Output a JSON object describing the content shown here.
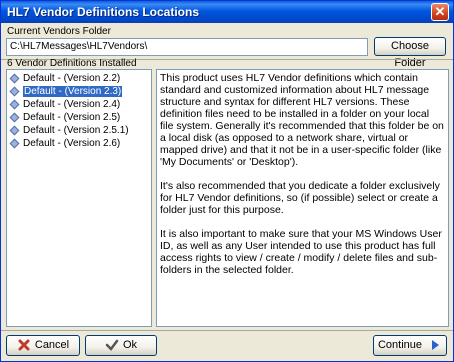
{
  "window": {
    "title": "HL7 Vendor Definitions Locations"
  },
  "current_folder": {
    "label": "Current Vendors Folder",
    "value": "C:\\HL7Messages\\HL7Vendors\\",
    "choose_button": "Choose Folder"
  },
  "installed": {
    "label": "6 Vendor Definitions Installed",
    "items": [
      "Default - (Version 2.2)",
      "Default - (Version 2.3)",
      "Default - (Version 2.4)",
      "Default - (Version 2.5)",
      "Default - (Version 2.5.1)",
      "Default - (Version 2.6)"
    ],
    "selected_index": 1
  },
  "info": {
    "paragraphs": [
      "This product uses HL7 Vendor definitions which contain standard and customized information about HL7 message structure and syntax for different HL7 versions. These definition files need to be installed in a folder on your local file system. Generally it's recommended that this folder be on a local disk (as opposed to a network share, virtual or mapped drive) and that it not be in a user-specific folder (like 'My Documents' or 'Desktop').",
      "It's also recommended that you dedicate a folder exclusively for HL7 Vendor definitions, so (if possible) select or create a folder just for this purpose.",
      "It is also important to make sure that your MS Windows User ID, as well as any User intended to use  this product has full access rights to view / create / modify / delete files and sub-folders in the selected folder."
    ]
  },
  "footer": {
    "cancel": "Cancel",
    "ok": "Ok",
    "continue": "Continue"
  },
  "colors": {
    "selection": "#316ac5",
    "titlebar": "#0054e3"
  },
  "icons": {
    "cancel": "red-x-icon",
    "ok": "check-icon",
    "continue": "blue-arrow-right-icon",
    "list_item": "diamond-icon"
  }
}
